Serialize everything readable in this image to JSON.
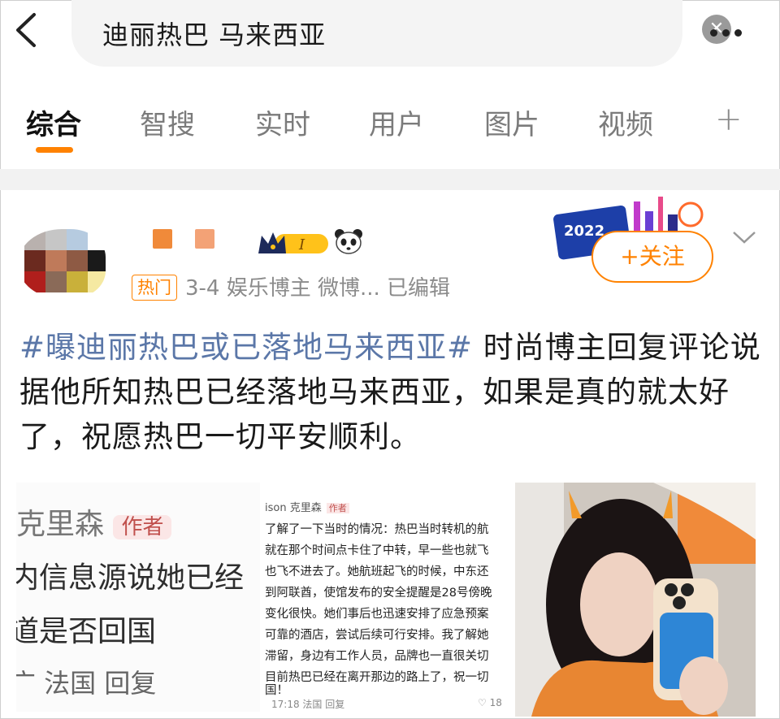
{
  "search": {
    "query": "迪丽热巴 马来西亚"
  },
  "tabs": [
    {
      "label": "综合"
    },
    {
      "label": "智搜"
    },
    {
      "label": "实时"
    },
    {
      "label": "用户"
    },
    {
      "label": "图片"
    },
    {
      "label": "视频"
    }
  ],
  "tabs_more": "+",
  "post": {
    "badge": "热门",
    "meta": "3-4  娱乐博主 微博...  已编辑",
    "follow_label": "+关注",
    "banner_text": "2022",
    "hashtag": "#曝迪丽热巴或已落地马来西亚#",
    "text": " 时尚博主回复评论说据他所知热巴已经落地马来西亚，如果是真的就太好了，祝愿热巴一切平安顺利。"
  },
  "image1": {
    "author": "克里森",
    "author_badge": "作者",
    "lines": [
      "内信息源说她已经",
      "道是否回国",
      "广 法国   回复"
    ]
  },
  "image2": {
    "header": "ison 克里森",
    "header_badge": "作者",
    "lines": [
      "了解了一下当时的情况：热巴当时转机的航",
      "就在那个时间点卡住了中转，早一些也就飞",
      "也飞不进去了。她航班起飞的时候，中东还",
      "到阿联酋，使馆发布的安全提醒是28号傍晚",
      "变化很快。她们事后也迅速安排了应急预案",
      "可靠的酒店，尝试后续可行安排。我了解她",
      "滞留，身边有工作人员，品牌也一直很关切",
      "目前热巴已经在离开那边的路上了，祝一切",
      "国！"
    ],
    "footer": "17:18 法国  回复",
    "likes": "18"
  },
  "colors": {
    "accent": "#ff8200",
    "hashtag": "#5b77a8"
  }
}
